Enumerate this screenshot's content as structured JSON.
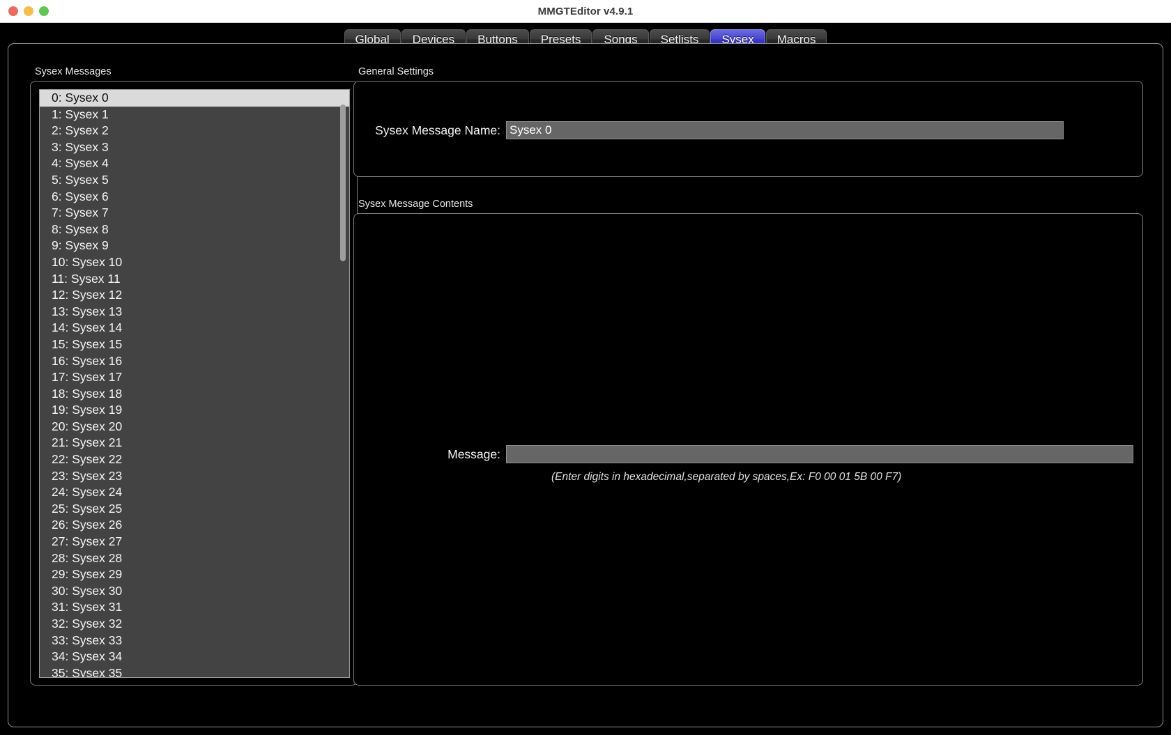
{
  "window": {
    "title": "MMGTEditor v4.9.1",
    "traffic_lights": [
      {
        "name": "close",
        "color": "#ec6a5f"
      },
      {
        "name": "minimize",
        "color": "#f4bd4f"
      },
      {
        "name": "maximize",
        "color": "#61c554"
      }
    ]
  },
  "tabs": {
    "active": "Sysex",
    "items": [
      {
        "label": "Global"
      },
      {
        "label": "Devices"
      },
      {
        "label": "Buttons"
      },
      {
        "label": "Presets"
      },
      {
        "label": "Songs"
      },
      {
        "label": "Setlists"
      },
      {
        "label": "Sysex"
      },
      {
        "label": "Macros"
      }
    ]
  },
  "left_panel": {
    "group_label": "Sysex Messages",
    "selected_index": 0,
    "items": [
      "0: Sysex 0",
      "1: Sysex 1",
      "2: Sysex 2",
      "3: Sysex 3",
      "4: Sysex 4",
      "5: Sysex 5",
      "6: Sysex 6",
      "7: Sysex 7",
      "8: Sysex 8",
      "9: Sysex 9",
      "10: Sysex 10",
      "11: Sysex 11",
      "12: Sysex 12",
      "13: Sysex 13",
      "14: Sysex 14",
      "15: Sysex 15",
      "16: Sysex 16",
      "17: Sysex 17",
      "18: Sysex 18",
      "19: Sysex 19",
      "20: Sysex 20",
      "21: Sysex 21",
      "22: Sysex 22",
      "23: Sysex 23",
      "24: Sysex 24",
      "25: Sysex 25",
      "26: Sysex 26",
      "27: Sysex 27",
      "28: Sysex 28",
      "29: Sysex 29",
      "30: Sysex 30",
      "31: Sysex 31",
      "32: Sysex 32",
      "33: Sysex 33",
      "34: Sysex 34",
      "35: Sysex 35"
    ]
  },
  "general_settings": {
    "group_label": "General Settings",
    "name_label": "Sysex Message Name:",
    "name_value": "Sysex 0",
    "name_placeholder": ""
  },
  "message_contents": {
    "group_label": "Sysex Message Contents",
    "message_label": "Message:",
    "message_value": "",
    "message_placeholder": "",
    "hint": "(Enter digits in hexadecimal,separated by spaces,Ex: F0 00 01 5B 00 F7)"
  },
  "colors": {
    "accent": "#4a45cf",
    "panel_border": "#7e7e7e",
    "list_bg": "#434343",
    "input_bg": "#666666",
    "selection_bg": "#dadada"
  }
}
